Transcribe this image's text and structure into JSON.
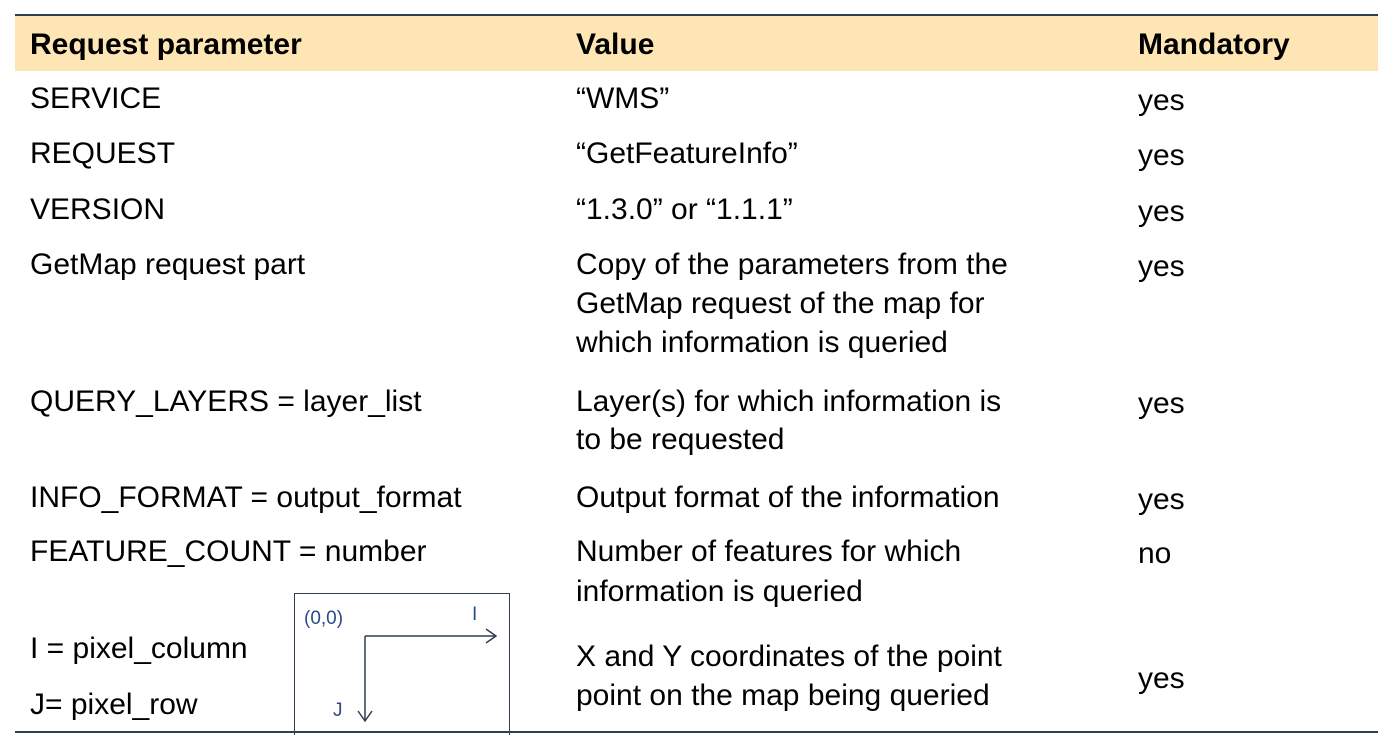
{
  "table": {
    "headers": [
      "Request parameter",
      "Value",
      "Mandatory"
    ],
    "rows": [
      {
        "param": "SERVICE",
        "value": "“WMS”",
        "mandatory": "yes"
      },
      {
        "param": "REQUEST",
        "value": "“GetFeatureInfo”",
        "mandatory": "yes"
      },
      {
        "param": "VERSION",
        "value": "“1.3.0” or “1.1.1”",
        "mandatory": "yes"
      },
      {
        "param": "GetMap request part",
        "value": [
          "Copy of the parameters from the",
          "GetMap request of the map for",
          "which information is queried"
        ],
        "mandatory": "yes"
      },
      {
        "param": "QUERY_LAYERS = layer_list",
        "value": [
          "Layer(s) for which information is",
          "to be requested"
        ],
        "mandatory": "yes"
      },
      {
        "param": "INFO_FORMAT = output_format",
        "value": "Output format of the information",
        "mandatory": "yes"
      },
      {
        "param": "FEATURE_COUNT = number",
        "value": [
          "Number of features for which",
          "information is queried"
        ],
        "mandatory": "no"
      },
      {
        "param": [
          "I = pixel_column",
          "J= pixel_row"
        ],
        "value": [
          "X and Y coordinates of the point",
          "point on the map being queried"
        ],
        "mandatory": "yes"
      }
    ]
  },
  "diagram": {
    "origin_label": "(0,0)",
    "i_label": "I",
    "j_label": "J"
  },
  "colors": {
    "header_bg": "#fde6b3",
    "rule": "#2f3f52",
    "diagram_label": "#2a4a8a"
  }
}
